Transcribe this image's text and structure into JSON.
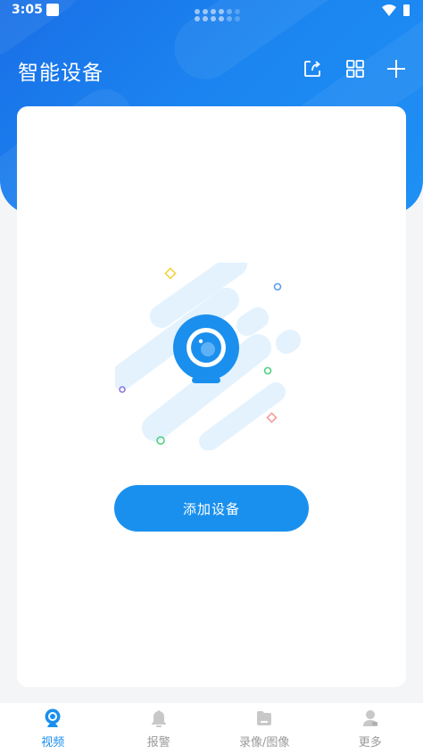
{
  "status_bar": {
    "time": "3:05"
  },
  "header": {
    "title": "智能设备",
    "actions": [
      {
        "icon": "share-icon"
      },
      {
        "icon": "grid-icon"
      },
      {
        "icon": "plus-icon"
      }
    ]
  },
  "empty_state": {
    "button_label": "添加设备"
  },
  "tab_bar": {
    "items": [
      {
        "label": "视频",
        "icon": "camera-icon",
        "active": true
      },
      {
        "label": "报警",
        "icon": "bell-icon",
        "active": false
      },
      {
        "label": "录像/图像",
        "icon": "folder-icon",
        "active": false
      },
      {
        "label": "更多",
        "icon": "user-icon",
        "active": false
      }
    ]
  },
  "colors": {
    "primary": "#1a8fee",
    "header": "#1b84f0",
    "inactive": "#9a9a9a"
  }
}
